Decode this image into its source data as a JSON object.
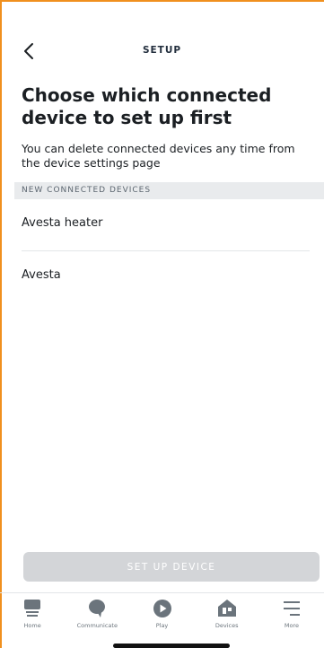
{
  "header": {
    "back_icon": "chevron-left-icon",
    "title": "SETUP"
  },
  "main": {
    "title": "Choose which connected device to set up first",
    "subtitle": "You can delete connected devices any time from the device settings page",
    "section_header": "NEW CONNECTED DEVICES",
    "devices": [
      {
        "label": "Avesta heater"
      },
      {
        "label": "Avesta"
      }
    ],
    "setup_button_label": "SET UP DEVICE"
  },
  "nav": {
    "items": [
      {
        "label": "Home",
        "icon": "home-icon"
      },
      {
        "label": "Communicate",
        "icon": "chat-bubble-icon"
      },
      {
        "label": "Play",
        "icon": "play-icon"
      },
      {
        "label": "Devices",
        "icon": "devices-icon"
      },
      {
        "label": "More",
        "icon": "menu-icon"
      }
    ]
  },
  "colors": {
    "accent_border": "#f0901e",
    "disabled_button": "#d3d5d8",
    "section_background": "#e9ebed",
    "nav_icon": "#6b747c"
  }
}
